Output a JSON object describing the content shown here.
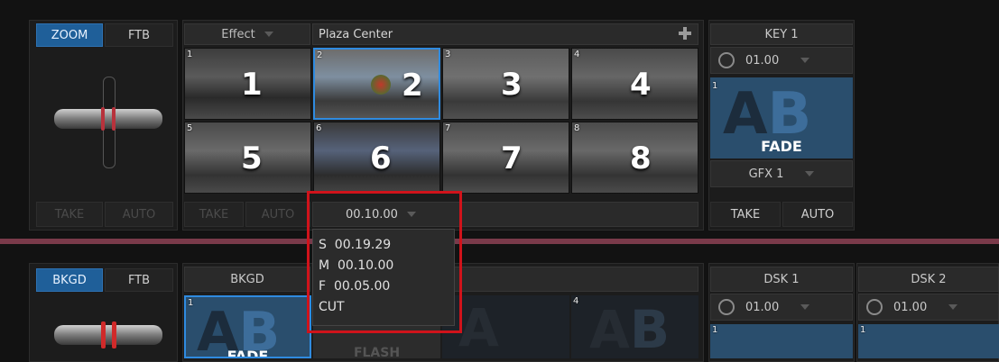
{
  "top": {
    "zoom_label": "ZOOM",
    "ftb_label": "FTB",
    "take_label": "TAKE",
    "auto_label": "AUTO",
    "effect_label": "Effect",
    "title": "Plaza Center",
    "add_icon": "plus-icon",
    "thumbs": [
      {
        "num": "1",
        "big": "1"
      },
      {
        "num": "2",
        "big": "2"
      },
      {
        "num": "3",
        "big": "3"
      },
      {
        "num": "4",
        "big": "4"
      },
      {
        "num": "5",
        "big": "5"
      },
      {
        "num": "6",
        "big": "6"
      },
      {
        "num": "7",
        "big": "7"
      },
      {
        "num": "8",
        "big": "8"
      }
    ],
    "speed_value": "00.10.00",
    "mid_take": "TAKE",
    "mid_auto": "AUTO"
  },
  "dropdown": {
    "items": [
      "S  00.19.29",
      "M  00.10.00",
      "F  00.05.00",
      "CUT"
    ]
  },
  "key": {
    "title": "KEY 1",
    "value": "01.00",
    "slot": "1",
    "fade": "FADE",
    "gfx": "GFX 1",
    "take": "TAKE",
    "auto": "AUTO"
  },
  "bottom": {
    "bkgd_label": "BKGD",
    "ftb_label": "FTB",
    "header_label": "BKGD",
    "slot1": "1",
    "fade": "FADE",
    "flash": "FLASH",
    "slot4": "4",
    "dsk1": {
      "title": "DSK 1",
      "value": "01.00",
      "slot": "1"
    },
    "dsk2": {
      "title": "DSK 2",
      "value": "01.00",
      "slot": "1"
    }
  },
  "colors": {
    "accent": "#1f5f99",
    "highlight": "#d0131b",
    "divider": "#7a3a4a",
    "tbar_red": "#b8323c"
  }
}
